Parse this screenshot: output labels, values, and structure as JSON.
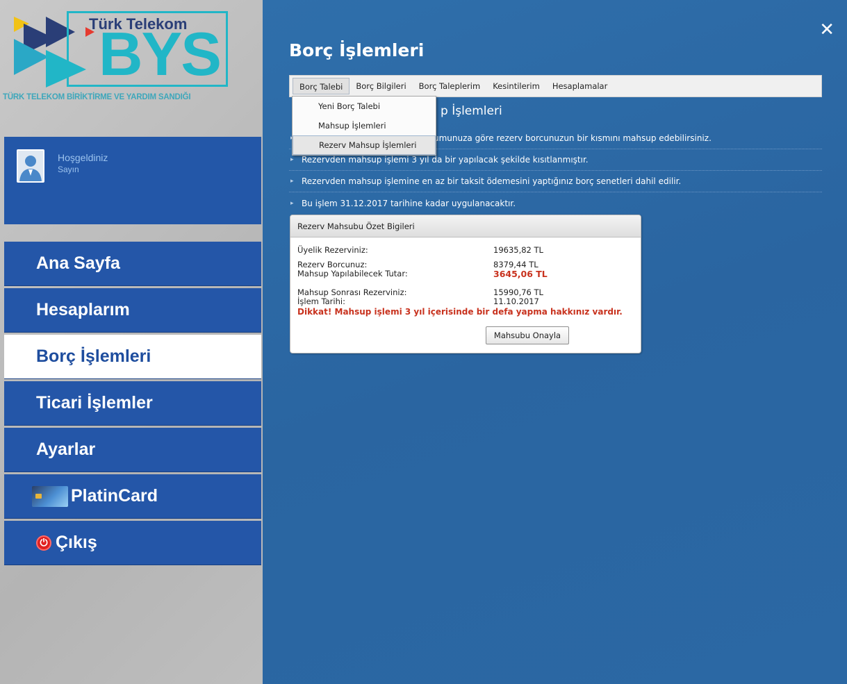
{
  "brand": {
    "company": "Türk Telekom",
    "acronym": "BYS",
    "subtitle": "TÜRK TELEKOM BİRİKTİRME VE YARDIM SANDIĞI"
  },
  "welcome": {
    "greeting": "Hoşgeldiniz",
    "salutation": "Sayın"
  },
  "nav": {
    "items": [
      {
        "label": "Ana Sayfa",
        "icon": ""
      },
      {
        "label": "Hesaplarım",
        "icon": ""
      },
      {
        "label": "Borç İşlemleri",
        "icon": "",
        "active": true
      },
      {
        "label": "Ticari İşlemler",
        "icon": ""
      },
      {
        "label": "Ayarlar",
        "icon": ""
      },
      {
        "label": "PlatinCard",
        "icon": "platin-card-icon"
      },
      {
        "label": "Çıkış",
        "icon": "power-icon"
      }
    ]
  },
  "page": {
    "title": "Borç İşlemleri",
    "close_icon": "close-icon"
  },
  "menubar": {
    "items": [
      "Borç Talebi",
      "Borç Bilgileri",
      "Borç Taleplerim",
      "Kesintilerim",
      "Hesaplamalar"
    ],
    "open_index": 0
  },
  "dropdown": {
    "items": [
      "Yeni Borç Talebi",
      "Mahsup İşlemleri",
      "Rezerv Mahsup İşlemleri"
    ],
    "hovered_index": 2
  },
  "section": {
    "heading_visible": "p İşlemleri",
    "bullets": [
      "umunuza göre rezerv borcunuzun bir kısmını mahsup edebilirsiniz.",
      "Rezervden mahsup işlemi 3 yıl da bir yapılacak şekilde kısıtlanmıştır.",
      "Rezervden mahsup işlemine en az bir taksit ödemesini yaptığınız borç senetleri dahil edilir.",
      "Bu işlem 31.12.2017 tarihine kadar uygulanacaktır."
    ]
  },
  "summary": {
    "title": "Rezerv Mahsubu Özet Bigileri",
    "rows1": [
      {
        "label": "Üyelik Rezerviniz:",
        "value": "19635,82 TL"
      },
      {
        "label": "Rezerv Borcunuz:",
        "value": "8379,44 TL"
      },
      {
        "label": "Mahsup Yapılabilecek Tutar:",
        "value": "3645,06 TL"
      }
    ],
    "rows2": [
      {
        "label": "Mahsup Sonrası Rezerviniz:",
        "value": "15990,76 TL"
      },
      {
        "label": "İşlem Tarihi:",
        "value": "11.10.2017"
      }
    ],
    "warning": "Dikkat! Mahsup işlemi 3 yıl içerisinde bir defa yapma hakkınız vardır.",
    "approve_label": "Mahsubu Onayla"
  },
  "colors": {
    "accent_blue": "#2456a8",
    "main_bg": "#2b68a4",
    "warning_red": "#c8321e",
    "logo_teal": "#21b6c7"
  }
}
